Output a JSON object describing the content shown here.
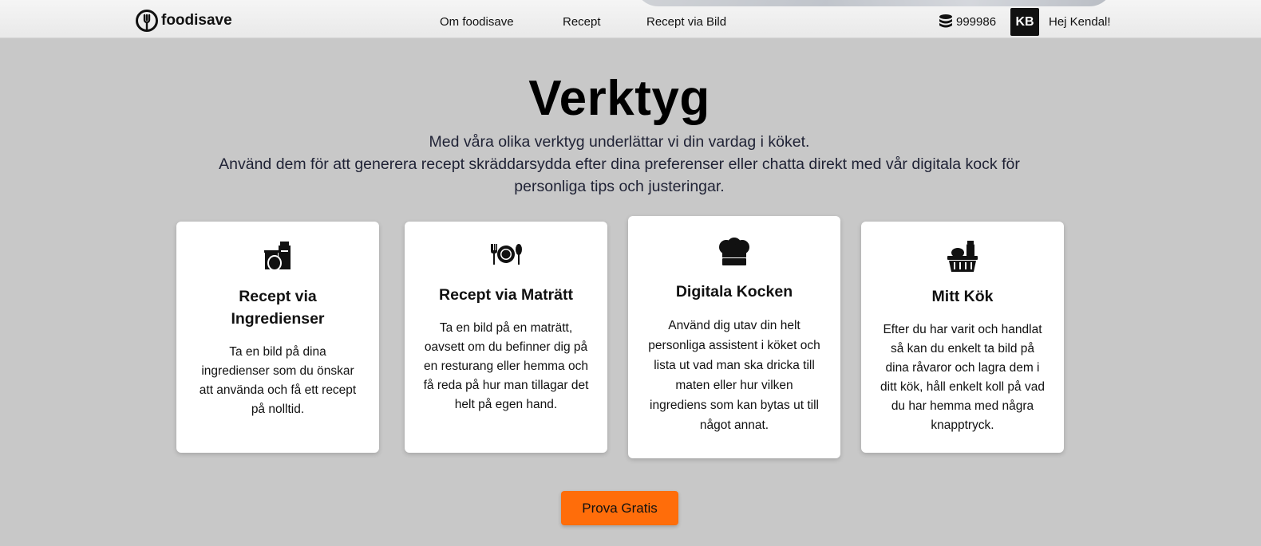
{
  "header": {
    "brand": "foodisave",
    "nav": [
      "Om foodisave",
      "Recept",
      "Recept via Bild"
    ],
    "coins": "999986",
    "avatar_initials": "KB",
    "greeting": "Hej Kendal!"
  },
  "hero": {
    "title": "Verktyg",
    "subtitle_line1": "Med våra olika verktyg underlättar vi din vardag i köket.",
    "subtitle_line2": "Använd dem för att generera recept skräddarsydda efter dina preferenser eller chatta direkt med vår digitala kock för personliga tips och justeringar."
  },
  "cards": [
    {
      "icon": "ingredients-icon",
      "title": "Recept via Ingredienser",
      "text": "Ta en bild på dina ingredienser som du önskar att använda och få ett recept på nolltid."
    },
    {
      "icon": "plate-cutlery-icon",
      "title": "Recept via Maträtt",
      "text": "Ta en bild på en maträtt, oavsett om du befinner dig på en resturang eller hemma och få reda på hur man tillagar det helt på egen hand."
    },
    {
      "icon": "chef-hat-icon",
      "title": "Digitala Kocken",
      "text": "Använd dig utav din helt personliga assistent i köket och lista ut vad man ska dricka till maten eller hur vilken ingrediens som kan bytas ut till något annat."
    },
    {
      "icon": "grocery-basket-icon",
      "title": "Mitt Kök",
      "text": "Efter du har varit och handlat så kan du enkelt ta bild på dina råvaror och lagra dem i ditt kök, håll enkelt koll på vad du har hemma med några knapptryck."
    }
  ],
  "cta_label": "Prova Gratis"
}
